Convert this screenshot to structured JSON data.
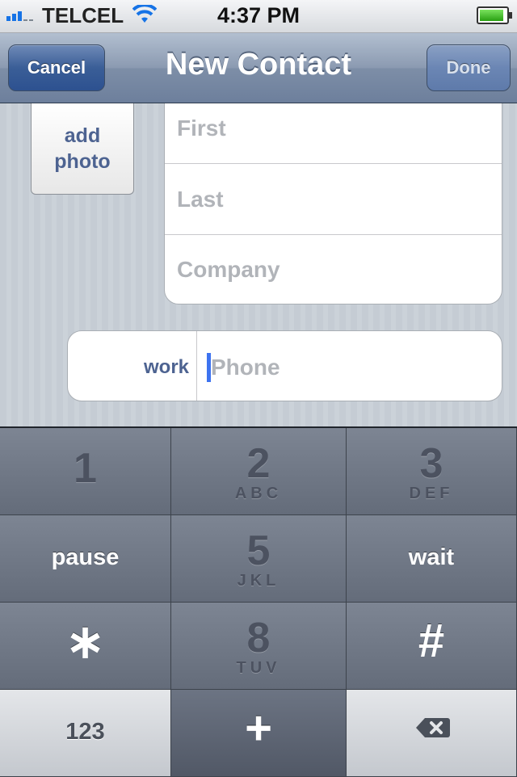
{
  "status_bar": {
    "carrier": "TELCEL",
    "time": "4:37 PM",
    "signal_bars": 2,
    "signal_max": 5,
    "battery_level": 0.9,
    "icons": [
      "signal-icon",
      "wifi-icon",
      "battery-icon"
    ]
  },
  "nav": {
    "title": "New Contact",
    "cancel_label": "Cancel",
    "done_label": "Done"
  },
  "photo": {
    "line1": "add",
    "line2": "photo"
  },
  "name_fields": {
    "first_placeholder": "First",
    "last_placeholder": "Last",
    "company_placeholder": "Company"
  },
  "phone": {
    "label": "work",
    "placeholder": "Phone"
  },
  "keypad": {
    "row1": [
      {
        "main": "1",
        "sub": ""
      },
      {
        "main": "2",
        "sub": "ABC"
      },
      {
        "main": "3",
        "sub": "DEF"
      }
    ],
    "row2": [
      {
        "main": "pause"
      },
      {
        "main": "5",
        "sub": "JKL"
      },
      {
        "main": "wait"
      }
    ],
    "row3": [
      {
        "main": "∗"
      },
      {
        "main": "8",
        "sub": "TUV"
      },
      {
        "main": "#"
      }
    ],
    "row4": [
      {
        "main": "123"
      },
      {
        "main": "+"
      },
      {
        "main": "delete-icon"
      }
    ]
  },
  "colors": {
    "nav_accent": "#3a5e97",
    "label_blue": "#4d6391",
    "caret": "#3d73f0"
  }
}
